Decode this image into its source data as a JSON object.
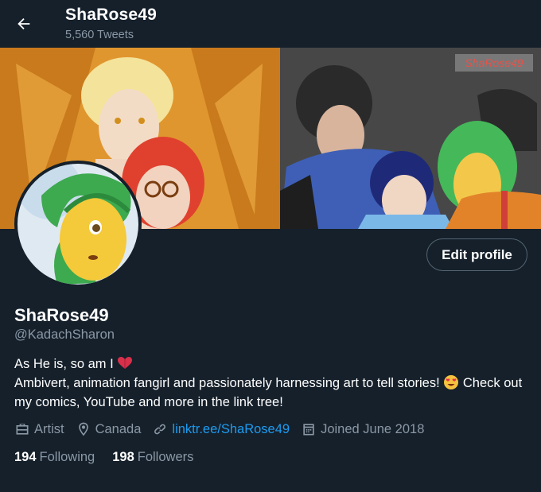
{
  "header": {
    "back_icon": "arrow-left-icon",
    "title": "ShaRose49",
    "tweet_count": "5,560 Tweets"
  },
  "banner": {
    "watermark": "ShaRose49",
    "description": ""
  },
  "avatar": {
    "alt": ""
  },
  "actions": {
    "edit_profile_label": "Edit profile"
  },
  "profile": {
    "display_name": "ShaRose49",
    "handle": "@KadachSharon",
    "bio_line1": "As He is, so am I",
    "bio_emoji1": "heart-icon",
    "bio_line2_part1": "Ambivert, animation fangirl and passionately harnessing art to tell stories!",
    "bio_emoji2": "heart-eyes-emoji",
    "bio_line2_part2": " Check out my comics, YouTube and more in the link tree!"
  },
  "meta": {
    "profession": "Artist",
    "location": "Canada",
    "website": "linktr.ee/ShaRose49",
    "joined": "Joined June 2018",
    "icons": {
      "profession": "briefcase-icon",
      "location": "location-pin-icon",
      "website": "link-icon",
      "joined": "calendar-icon"
    }
  },
  "stats": {
    "following_count": "194",
    "following_label": "Following",
    "followers_count": "198",
    "followers_label": "Followers"
  },
  "colors": {
    "background": "#15202b",
    "secondary_text": "#8b98a5",
    "link": "#1d9bf0",
    "button_border": "#536471"
  }
}
